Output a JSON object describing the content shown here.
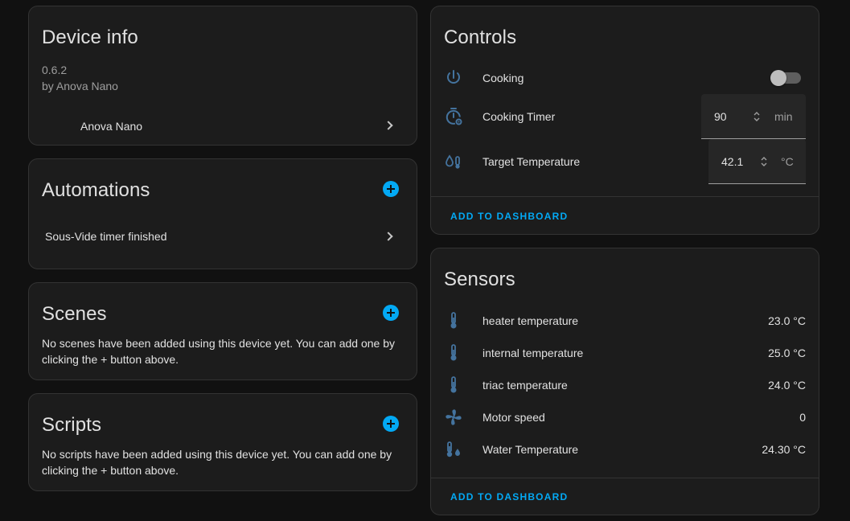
{
  "device_info": {
    "title": "Device info",
    "version": "0.6.2",
    "by": "by Anova Nano",
    "device_link": "Anova Nano"
  },
  "automations": {
    "title": "Automations",
    "items": [
      {
        "label": "Sous-Vide timer finished"
      }
    ]
  },
  "scenes": {
    "title": "Scenes",
    "empty_text": "No scenes have been added using this device yet. You can add one by clicking the + button above."
  },
  "scripts": {
    "title": "Scripts",
    "empty_text": "No scripts have been added using this device yet. You can add one by clicking the + button above."
  },
  "controls": {
    "title": "Controls",
    "cooking": {
      "label": "Cooking",
      "icon": "power-icon",
      "state": "off"
    },
    "timer": {
      "label": "Cooking Timer",
      "icon": "timer-cog-icon",
      "value": "90",
      "unit": "min"
    },
    "target_temp": {
      "label": "Target Temperature",
      "icon": "thermometer-water-icon",
      "value": "42.1",
      "unit": "°C"
    },
    "action": "ADD TO DASHBOARD"
  },
  "sensors": {
    "title": "Sensors",
    "items": [
      {
        "label": "heater temperature",
        "value": "23.0 °C",
        "icon": "thermometer-icon"
      },
      {
        "label": "internal temperature",
        "value": "25.0 °C",
        "icon": "thermometer-icon"
      },
      {
        "label": "triac temperature",
        "value": "24.0 °C",
        "icon": "thermometer-icon"
      },
      {
        "label": "Motor speed",
        "value": "0",
        "icon": "fan-icon"
      },
      {
        "label": "Water Temperature",
        "value": "24.30 °C",
        "icon": "thermometer-water-icon"
      }
    ],
    "action": "ADD TO DASHBOARD"
  },
  "colors": {
    "accent": "#03a9f4",
    "icon": "#44739e",
    "card_bg": "#1c1c1c",
    "page_bg": "#111111"
  }
}
